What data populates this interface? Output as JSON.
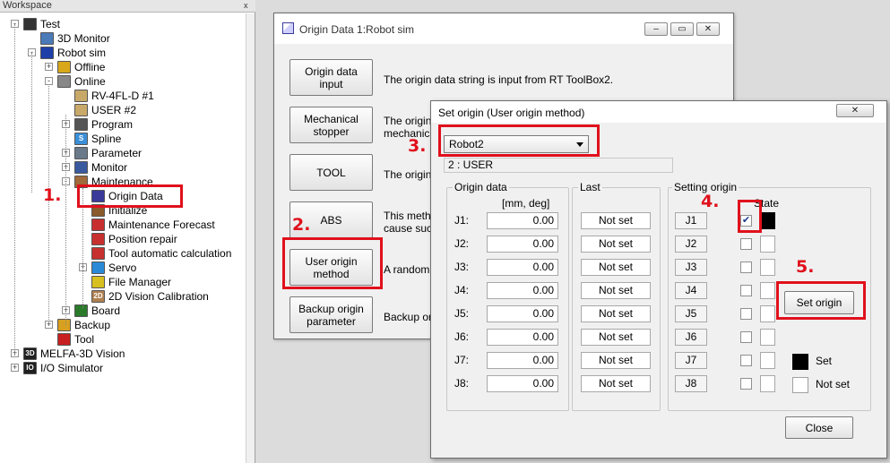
{
  "workspace": {
    "title": "Workspace",
    "pin": "x",
    "tree": [
      {
        "label": "Test",
        "icon": "project-icon",
        "color": "#333333"
      },
      {
        "label": "3D Monitor",
        "icon": "monitor-3d-icon",
        "color": "#4a7ab8"
      },
      {
        "label": "Robot sim",
        "icon": "robot-sim-icon",
        "color": "#1e3fa8"
      },
      {
        "label": "Offline",
        "icon": "offline-icon",
        "color": "#d8a81a"
      },
      {
        "label": "Online",
        "icon": "online-icon",
        "color": "#888888"
      },
      {
        "label": "RV-4FL-D #1",
        "icon": "robot-mech-icon",
        "color": "#c8a96a"
      },
      {
        "label": "USER #2",
        "icon": "robot-mech-icon",
        "color": "#c8a96a"
      },
      {
        "label": "Program",
        "icon": "program-icon",
        "color": "#555555"
      },
      {
        "label": "Spline",
        "icon": "spline-icon",
        "color": "#3b8fd8"
      },
      {
        "label": "Parameter",
        "icon": "parameter-icon",
        "color": "#6a7a8a"
      },
      {
        "label": "Monitor",
        "icon": "monitor-icon",
        "color": "#3a5aa0"
      },
      {
        "label": "Maintenance",
        "icon": "maintenance-icon",
        "color": "#a06a3a"
      },
      {
        "label": "Origin Data",
        "icon": "origin-data-icon",
        "color": "#3a3a9a"
      },
      {
        "label": "Initialize",
        "icon": "initialize-icon",
        "color": "#8a5a2a"
      },
      {
        "label": "Maintenance Forecast",
        "icon": "forecast-icon",
        "color": "#c83030"
      },
      {
        "label": "Position repair",
        "icon": "position-repair-icon",
        "color": "#c83030"
      },
      {
        "label": "Tool automatic calculation",
        "icon": "tool-calc-icon",
        "color": "#c83030"
      },
      {
        "label": "Servo",
        "icon": "servo-icon",
        "color": "#2a8ad8"
      },
      {
        "label": "File Manager",
        "icon": "file-manager-icon",
        "color": "#d8c020"
      },
      {
        "label": "2D Vision Calibration",
        "icon": "vision-2d-icon",
        "color": "#b08050"
      },
      {
        "label": "Board",
        "icon": "board-icon",
        "color": "#2a7a2a"
      },
      {
        "label": "Backup",
        "icon": "backup-icon",
        "color": "#d8a020"
      },
      {
        "label": "Tool",
        "icon": "tool-icon",
        "color": "#c82020"
      },
      {
        "label": "MELFA-3D Vision",
        "icon": "melfa-3d-icon",
        "color": "#202020"
      },
      {
        "label": "I/O Simulator",
        "icon": "io-simulator-icon",
        "color": "#202020"
      }
    ],
    "icon_text": {
      "melfa": "3D",
      "io": "IO",
      "vision": "2D",
      "spline": "S"
    }
  },
  "origin_window": {
    "title": "Origin Data 1:Robot sim",
    "controls": {
      "minimize": "–",
      "maximize": "▭",
      "close": "✕"
    },
    "buttons": [
      {
        "label": "Origin data\ninput",
        "desc": "The origin data string is input from RT ToolBox2."
      },
      {
        "label": "Mechanical\nstopper",
        "desc": "The origin\nmechanica"
      },
      {
        "label": "TOOL",
        "desc": "The origin"
      },
      {
        "label": "ABS",
        "desc": "This meth\ncause such"
      },
      {
        "label": "User origin\nmethod",
        "desc": "A random"
      },
      {
        "label": "Backup origin\nparameter",
        "desc": "Backup or"
      }
    ]
  },
  "set_origin_dialog": {
    "title": "Set origin (User origin method)",
    "close_glyph": "✕",
    "robot_select": {
      "value": "Robot2"
    },
    "robot_info": "2 : USER",
    "origin_data": {
      "label": "Origin data",
      "units": "[mm, deg]"
    },
    "last": {
      "label": "Last"
    },
    "setting_origin": {
      "label": "Setting origin",
      "state_label": "State"
    },
    "joints": [
      {
        "name": "J1:",
        "value": "0.00",
        "last": "Not set",
        "setting": "J1",
        "checked": true,
        "state": "set"
      },
      {
        "name": "J2:",
        "value": "0.00",
        "last": "Not set",
        "setting": "J2",
        "checked": false,
        "state": "not-set"
      },
      {
        "name": "J3:",
        "value": "0.00",
        "last": "Not set",
        "setting": "J3",
        "checked": false,
        "state": "not-set"
      },
      {
        "name": "J4:",
        "value": "0.00",
        "last": "Not set",
        "setting": "J4",
        "checked": false,
        "state": "not-set"
      },
      {
        "name": "J5:",
        "value": "0.00",
        "last": "Not set",
        "setting": "J5",
        "checked": false,
        "state": "not-set"
      },
      {
        "name": "J6:",
        "value": "0.00",
        "last": "Not set",
        "setting": "J6",
        "checked": false,
        "state": "not-set"
      },
      {
        "name": "J7:",
        "value": "0.00",
        "last": "Not set",
        "setting": "J7",
        "checked": false,
        "state": "not-set"
      },
      {
        "name": "J8:",
        "value": "0.00",
        "last": "Not set",
        "setting": "J8",
        "checked": false,
        "state": "not-set"
      }
    ],
    "set_origin_button": "Set origin",
    "legend": {
      "set": "Set",
      "not_set": "Not set"
    },
    "close_button": "Close"
  },
  "annotations": {
    "color": "#e0101c",
    "steps": [
      "1.",
      "2.",
      "3.",
      "4.",
      "5."
    ]
  }
}
